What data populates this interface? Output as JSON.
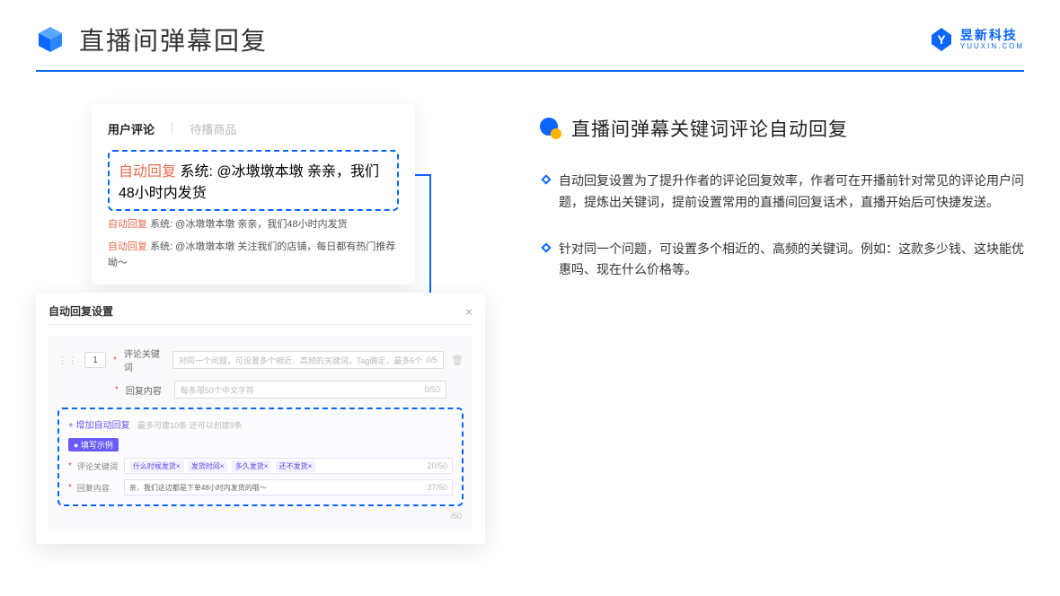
{
  "header": {
    "title": "直播间弹幕回复",
    "brand_cn": "昱新科技",
    "brand_en": "YUUXIN.COM"
  },
  "comments_card": {
    "tabs": {
      "active": "用户评论",
      "inactive": "待播商品"
    },
    "highlighted": {
      "tag": "自动回复",
      "text": "系统: @冰墩墩本墩 亲亲，我们48小时内发货"
    },
    "lines": [
      {
        "tag": "自动回复",
        "text": "系统: @冰墩墩本墩 亲亲，我们48小时内发货"
      },
      {
        "tag": "自动回复",
        "text": "系统: @冰墩墩本墩 关注我们的店铺，每日都有热门推荐呦～"
      }
    ]
  },
  "settings_card": {
    "title": "自动回复设置",
    "index": "1",
    "rows": {
      "keyword_label": "评论关键词",
      "keyword_placeholder": "对同一个问题，可设置多个相近、高频的关键词，Tag确定，最多5个",
      "keyword_count": "0/5",
      "content_label": "回复内容",
      "content_placeholder": "每条限50个中文字符",
      "content_count": "0/50"
    },
    "example": {
      "add_link": "+ 增加自动回复",
      "add_note": "最多可建10条 还可以创建9条",
      "badge": "● 填写示例",
      "keyword_label": "评论关键词",
      "tags": [
        "什么时候发货×",
        "发货时间×",
        "多久发货×",
        "还不发货×"
      ],
      "keyword_count": "20/50",
      "content_label": "回复内容",
      "content_value": "亲，我们这边都是下单48小时内发货的哦～",
      "content_count": "37/50"
    },
    "bottom_count": "/50"
  },
  "right": {
    "heading": "直播间弹幕关键词评论自动回复",
    "bullets": [
      "自动回复设置为了提升作者的评论回复效率，作者可在开播前针对常见的评论用户问题，提炼出关键词，提前设置常用的直播间回复话术，直播开始后可快捷发送。",
      "针对同一个问题，可设置多个相近的、高频的关键词。例如：这款多少钱、这块能优惠吗、现在什么价格等。"
    ]
  }
}
